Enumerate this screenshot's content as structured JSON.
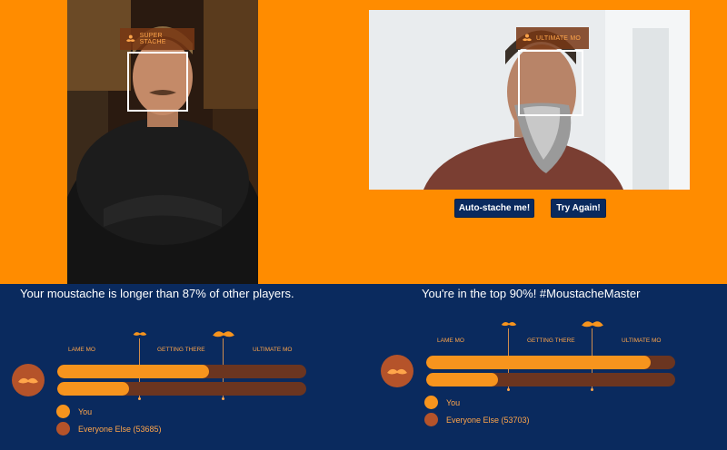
{
  "left_photo": {
    "tag_label": "SUPER STACHE"
  },
  "right_photo": {
    "tag_label": "ULTIMATE MO"
  },
  "buttons": {
    "autostache_label": "Auto-stache me!",
    "try_again_label": "Try Again!"
  },
  "left_result": {
    "headline": "Your moustache is longer than 87% of other players.",
    "scale_labels": [
      "LAME MO",
      "GETTING THERE",
      "ULTIMATE MO"
    ],
    "you_fraction": 0.61,
    "everyone_fraction": 0.29,
    "legend_you": "You",
    "legend_everyone": "Everyone Else (53685)"
  },
  "right_result": {
    "headline": "You're in the top 90%! #MoustacheMaster",
    "scale_labels": [
      "LAME MO",
      "GETTING THERE",
      "ULTIMATE MO"
    ],
    "you_fraction": 0.9,
    "everyone_fraction": 0.29,
    "legend_you": "You",
    "legend_everyone": "Everyone Else (53703)"
  },
  "colors": {
    "background": "#ff8c00",
    "panel": "#0a2a5e",
    "you": "#f7941d",
    "everyone": "#6b3520",
    "accent": "#ffa54a"
  },
  "icons": {
    "moustache": "moustache-icon",
    "avatar": "moustache-avatar-icon"
  }
}
